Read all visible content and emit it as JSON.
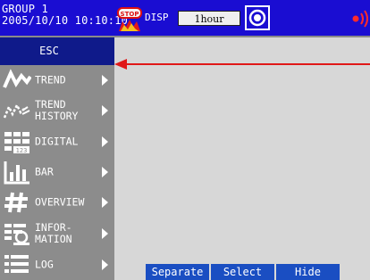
{
  "status": {
    "group": "GROUP 1",
    "datetime": "2005/10/10 10:10:10",
    "stop_badge": "STOP",
    "disp_label": "DISP",
    "time_span": "1hour"
  },
  "menu": {
    "esc_label": "ESC",
    "items": [
      {
        "label": "TREND",
        "icon": "trend-icon"
      },
      {
        "label": "TREND\nHISTORY",
        "icon": "trend-history-icon"
      },
      {
        "label": "DIGITAL",
        "icon": "digital-icon"
      },
      {
        "label": "BAR",
        "icon": "bar-icon"
      },
      {
        "label": "OVERVIEW",
        "icon": "overview-icon"
      },
      {
        "label": "INFOR-\nMATION",
        "icon": "information-icon"
      },
      {
        "label": "LOG",
        "icon": "log-icon"
      }
    ]
  },
  "softkeys": {
    "separate": "Separate",
    "select": "Select",
    "hide": "Hide"
  },
  "colors": {
    "status_bar": "#1a0dd2",
    "menu_bg": "#8c8c8c",
    "esc_bg": "#0f1a8a",
    "softkey_bg": "#1a4ec2",
    "annotation_arrow": "#e01818"
  }
}
